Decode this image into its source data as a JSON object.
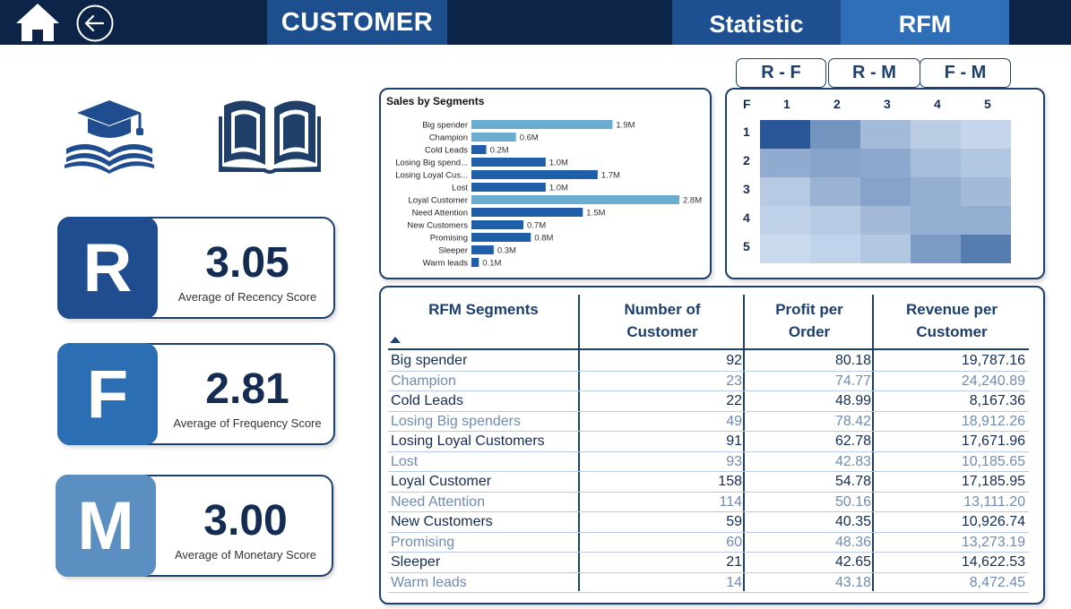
{
  "header": {
    "title": "CUSTOMER",
    "nav": [
      {
        "label": "Statistic"
      },
      {
        "label": "RFM"
      }
    ]
  },
  "colors": {
    "topbar": "#0c2447",
    "title_box": "#1d4f8f",
    "statistic_tab": "#1e4f91",
    "rfm_tab": "#2f6fb8",
    "r_tile": "#1f4d8f",
    "f_tile": "#2c6eb4",
    "m_tile": "#5b8fc2",
    "bar_highlight": "#6aadd0",
    "bar_normal": "#1f5ea8"
  },
  "kpis": [
    {
      "letter": "R",
      "value": "3.05",
      "label": "Average of Recency Score",
      "color": "#1f4d8f"
    },
    {
      "letter": "F",
      "value": "2.81",
      "label": "Average of Frequency Score",
      "color": "#2c6eb4"
    },
    {
      "letter": "M",
      "value": "3.00",
      "label": "Average of Monetary Score",
      "color": "#5b8fc2"
    }
  ],
  "heatmap": {
    "tabs": [
      "R - F",
      "R - M",
      "F - M"
    ],
    "row_axis_label": "F",
    "col_labels": [
      "1",
      "2",
      "3",
      "4",
      "5"
    ],
    "row_labels": [
      "1",
      "2",
      "3",
      "4",
      "5"
    ],
    "intensity": [
      [
        0.95,
        0.55,
        0.3,
        0.18,
        0.12
      ],
      [
        0.4,
        0.45,
        0.42,
        0.28,
        0.22
      ],
      [
        0.2,
        0.35,
        0.45,
        0.38,
        0.3
      ],
      [
        0.15,
        0.2,
        0.3,
        0.38,
        0.38
      ],
      [
        0.1,
        0.14,
        0.22,
        0.5,
        0.7
      ]
    ]
  },
  "chart_data": {
    "type": "bar",
    "orientation": "horizontal",
    "title": "Sales by Segments",
    "categories": [
      "Big spender",
      "Champion",
      "Cold Leads",
      "Losing Big spend...",
      "Losing Loyal Cus...",
      "Lost",
      "Loyal Customer",
      "Need Attention",
      "New Customers",
      "Promising",
      "Sleeper",
      "Warm leads"
    ],
    "values": [
      1.9,
      0.6,
      0.2,
      1.0,
      1.7,
      1.0,
      2.8,
      1.5,
      0.7,
      0.8,
      0.3,
      0.1
    ],
    "data_labels": [
      "1.9M",
      "0.6M",
      "0.2M",
      "1.0M",
      "1.7M",
      "1.0M",
      "2.8M",
      "1.5M",
      "0.7M",
      "0.8M",
      "0.3M",
      "0.1M"
    ],
    "highlighted": [
      true,
      true,
      false,
      false,
      false,
      false,
      true,
      false,
      false,
      false,
      false,
      false
    ],
    "unit": "M",
    "xlim": [
      0,
      2.8
    ],
    "grid": false,
    "legend": "none"
  },
  "table": {
    "columns": [
      "RFM Segments",
      "Number of Customer",
      "Profit per Order",
      "Revenue per Customer"
    ],
    "rows": [
      [
        "Big spender",
        "92",
        "80.18",
        "19,787.16"
      ],
      [
        "Champion",
        "23",
        "74.77",
        "24,240.89"
      ],
      [
        "Cold Leads",
        "22",
        "48.99",
        "8,167.36"
      ],
      [
        "Losing Big spenders",
        "49",
        "78.42",
        "18,912.26"
      ],
      [
        "Losing Loyal Customers",
        "91",
        "62.78",
        "17,671.96"
      ],
      [
        "Lost",
        "93",
        "42.83",
        "10,185.65"
      ],
      [
        "Loyal Customer",
        "158",
        "54.78",
        "17,185.95"
      ],
      [
        "Need Attention",
        "114",
        "50.16",
        "13,111.20"
      ],
      [
        "New Customers",
        "59",
        "40.35",
        "10,926.74"
      ],
      [
        "Promising",
        "60",
        "48.36",
        "13,273.19"
      ],
      [
        "Sleeper",
        "21",
        "42.65",
        "14,622.53"
      ],
      [
        "Warm leads",
        "14",
        "43.18",
        "8,472.45"
      ]
    ]
  }
}
